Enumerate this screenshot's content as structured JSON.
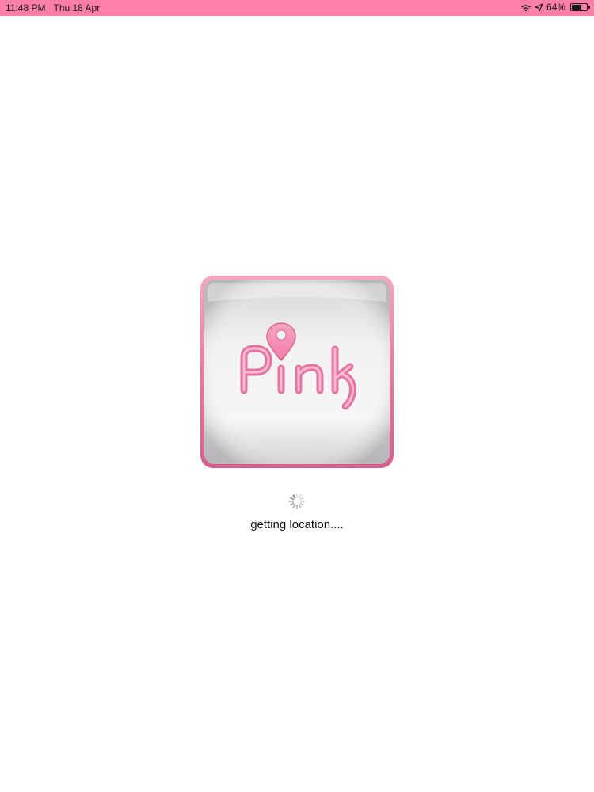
{
  "status_bar": {
    "time": "11:48 PM",
    "date": "Thu 18 Apr",
    "battery_percent_label": "64%",
    "battery_level": 0.64,
    "icons": [
      "wifi-icon",
      "location-arrow-icon",
      "battery-icon"
    ],
    "background_color": "#ff7fa8"
  },
  "splash": {
    "logo_text": "Pink",
    "logo_icon": "map-pin-icon",
    "brand_color": "#f47fa6",
    "loading_text": "getting location....",
    "spinner_icon": "activity-spinner-icon"
  }
}
